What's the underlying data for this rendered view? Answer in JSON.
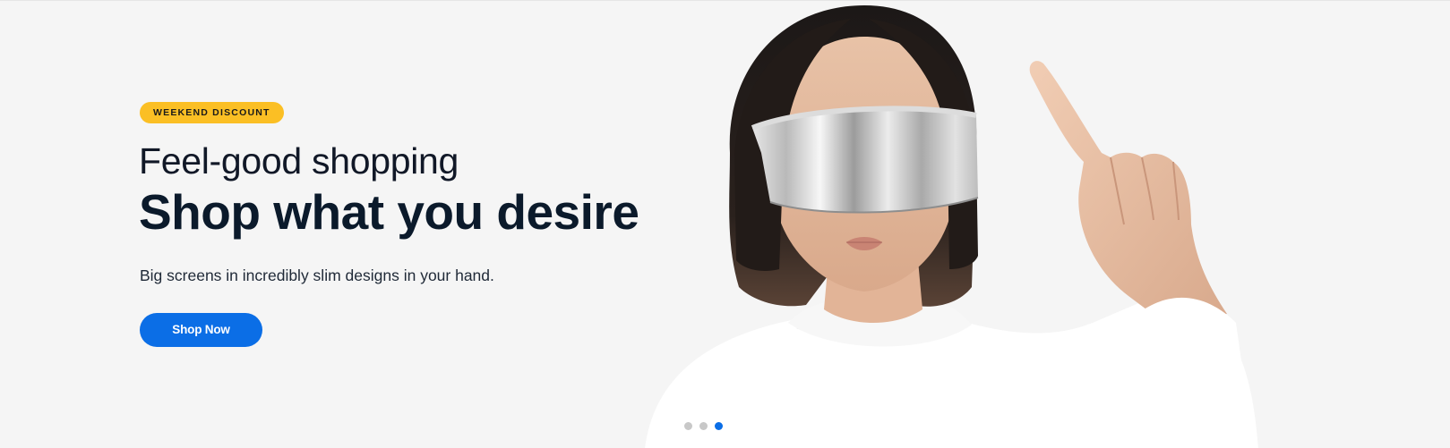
{
  "hero": {
    "badge": "WEEKEND DISCOUNT",
    "subtitle": "Feel-good shopping",
    "title": "Shop what you desire",
    "description": "Big screens in incredibly slim designs in your hand.",
    "cta_label": "Shop Now"
  },
  "carousel": {
    "slide_count": 3,
    "active_index": 3
  },
  "colors": {
    "badge_bg": "#fbbf24",
    "cta_bg": "#0b6ee6",
    "background": "#f5f5f5",
    "dot_active": "#0b6ee6",
    "dot_inactive": "#c8c8c8"
  },
  "image": {
    "subject": "woman-with-visor-glasses-pointing-up"
  }
}
